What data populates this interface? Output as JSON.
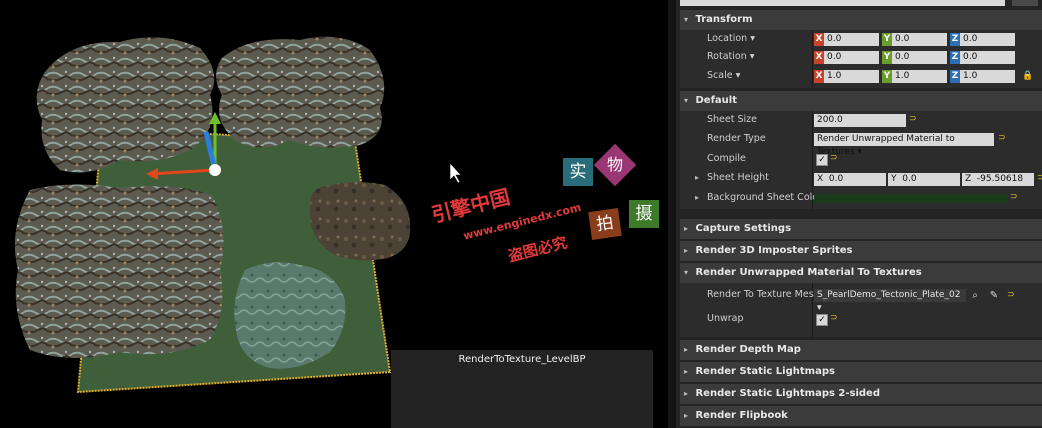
{
  "viewport": {
    "caption": "RenderToTexture_LevelBP",
    "watermark": {
      "shi": "实",
      "wu": "物",
      "pai": "拍",
      "she": "摄",
      "engine_cn": "引擎中国",
      "url": "www.enginedx.com",
      "warning": "盗图必究"
    },
    "colors": {
      "ground": "#3f5f3a",
      "outline": "#e0b030",
      "shi_bg": "#2a6d7a",
      "wu_bg": "#9a3772",
      "pai_bg": "#8a3d1a",
      "she_bg": "#3f7a2a",
      "red_text": "#e23a3a"
    }
  },
  "panel": {
    "transform": {
      "title": "Transform",
      "location": {
        "label": "Location",
        "x": "0.0",
        "y": "0.0",
        "z": "0.0"
      },
      "rotation": {
        "label": "Rotation",
        "x": "0.0",
        "y": "0.0",
        "z": "0.0"
      },
      "scale": {
        "label": "Scale",
        "x": "1.0",
        "y": "1.0",
        "z": "1.0"
      }
    },
    "default": {
      "title": "Default",
      "sheet_size": {
        "label": "Sheet Size",
        "value": "200.0"
      },
      "render_type": {
        "label": "Render Type",
        "value": "Render Unwrapped Material to Textures"
      },
      "compile": {
        "label": "Compile",
        "checked": "✓"
      },
      "sheet_height": {
        "label": "Sheet Height",
        "x": "0.0",
        "y": "0.0",
        "z": "-95.50618"
      },
      "background_sheet_color": {
        "label": "Background Sheet Color",
        "color": "#1c3a1c"
      }
    },
    "capture_settings": "Capture Settings",
    "render_3d_imposter": "Render 3D Imposter Sprites",
    "unwrapped": {
      "title": "Render Unwrapped Material To Textures",
      "mesh": {
        "label": "Render To Texture Mesh",
        "value": "S_PearlDemo_Tectonic_Plate_02"
      },
      "unwrap": {
        "label": "Unwrap",
        "checked": "✓"
      }
    },
    "render_depth_map": "Render Depth Map",
    "render_static_lightmaps": "Render Static Lightmaps",
    "render_static_lightmaps_2s": "Render Static Lightmaps 2-sided",
    "render_flipbook": "Render Flipbook",
    "axis": {
      "x": "X",
      "y": "Y",
      "z": "Z"
    },
    "icons": {
      "expanded": "▾",
      "collapsed": "▸",
      "dropdown": "▾",
      "reset": "⊃",
      "lock": "🔒",
      "search": "⌕",
      "eyedropper": "✎"
    }
  }
}
